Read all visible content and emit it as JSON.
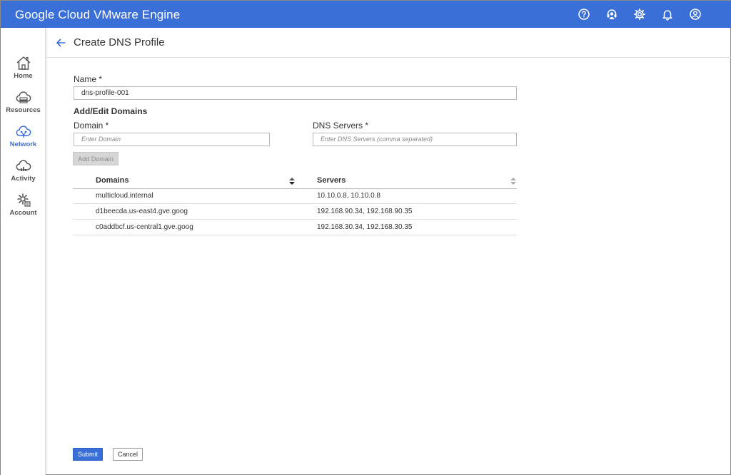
{
  "app": {
    "title": "Google Cloud VMware Engine"
  },
  "topbar": {
    "icons": [
      "help-icon",
      "support-icon",
      "settings-icon",
      "notifications-icon",
      "user-account-icon"
    ]
  },
  "sidebar": {
    "items": [
      {
        "label": "Home",
        "icon": "home-icon"
      },
      {
        "label": "Resources",
        "icon": "cloud-icon"
      },
      {
        "label": "Network",
        "icon": "network-cloud-icon",
        "active": true
      },
      {
        "label": "Activity",
        "icon": "activity-cloud-icon"
      },
      {
        "label": "Account",
        "icon": "account-gear-icon"
      }
    ]
  },
  "header": {
    "title": "Create DNS Profile"
  },
  "form": {
    "name_label": "Name *",
    "name_value": "dns-profile-001",
    "section_title": "Add/Edit Domains",
    "domain_label": "Domain *",
    "domain_placeholder": "Enter Domain",
    "servers_label": "DNS Servers *",
    "servers_placeholder": "Enter DNS Servers (comma separated)",
    "add_domain_label": "Add Domain"
  },
  "table": {
    "columns": [
      "Domains",
      "Servers"
    ],
    "rows": [
      {
        "domain": "multicloud.internal",
        "servers": "10.10.0.8, 10.10.0.8"
      },
      {
        "domain": "d1beecda.us-east4.gve.goog",
        "servers": "192.168.90.34, 192.168.90.35"
      },
      {
        "domain": "c0addbcf.us-central1.gve.goog",
        "servers": "192.168.30.34, 192.168.30.35"
      }
    ]
  },
  "footer": {
    "submit_label": "Submit",
    "cancel_label": "Cancel"
  },
  "colors": {
    "accent": "#3a6fd8",
    "topbar": "#3a6fd8",
    "disabled_button": "#d6d6d6"
  }
}
